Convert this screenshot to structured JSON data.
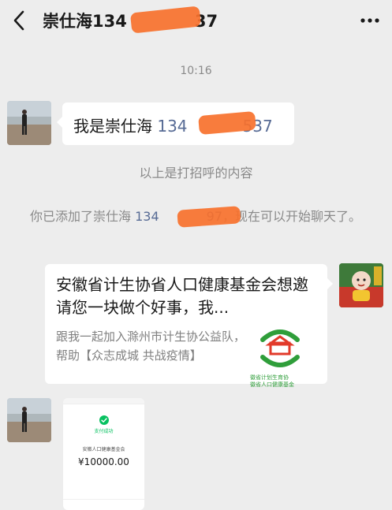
{
  "header": {
    "title_prefix": "崇仕海134",
    "title_suffix": "37",
    "back_icon": "chevron-left-icon",
    "more_icon": "more-horizontal-icon"
  },
  "chat": {
    "time": "10:16",
    "message1": {
      "prefix": "我是崇仕海 ",
      "phone_start": "134",
      "phone_end": "537"
    },
    "system_note": "以上是打招呼的内容",
    "added_note": {
      "prefix": "你已添加了崇仕海 ",
      "phone_start": "134",
      "phone_end": "97",
      "suffix": "，现在可以开始聊天了。"
    },
    "card": {
      "title": "安徽省计生协省人口健康基金会想邀请您一块做个好事，我...",
      "description": "跟我一起加入滁州市计生协公益队，帮助【众志成城 共战疫情】",
      "logo_caption_1": "徽省计划生育协",
      "logo_caption_2": "徽省人口健康基金"
    },
    "receipt": {
      "status": "支付成功",
      "payee": "安徽人口健康基金会",
      "amount": "¥10000.00"
    }
  },
  "colors": {
    "background": "#ededed",
    "bubble": "#ffffff",
    "link": "#576b95",
    "meta_text": "#8a8a8a",
    "redaction": "#f7712c",
    "wechat_green": "#07c160"
  }
}
